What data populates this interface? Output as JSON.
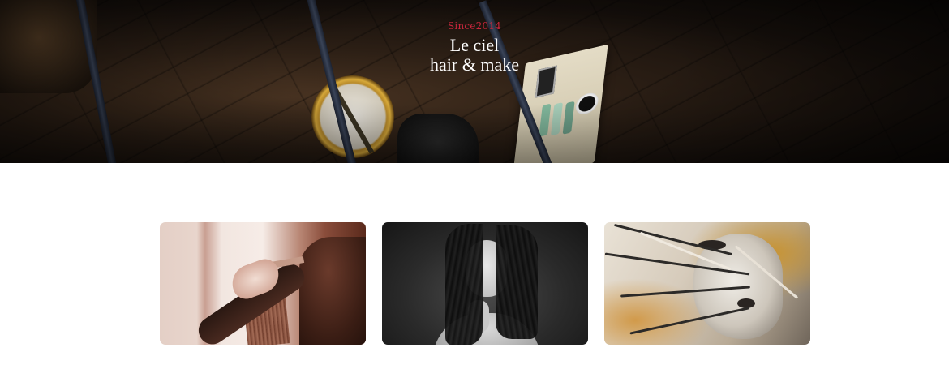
{
  "hero": {
    "since": "Since2014",
    "name_line1": "Le ciel",
    "name_line2": "hair & make"
  },
  "colors": {
    "accent": "#c7263c",
    "hero_text": "#ffffff",
    "page_background": "#ffffff"
  },
  "gallery": {
    "items": [
      {
        "subject": "hairdresser-cutting-hair"
      },
      {
        "subject": "woman-wind-blown-hair"
      },
      {
        "subject": "painted-face-portrait"
      }
    ]
  }
}
